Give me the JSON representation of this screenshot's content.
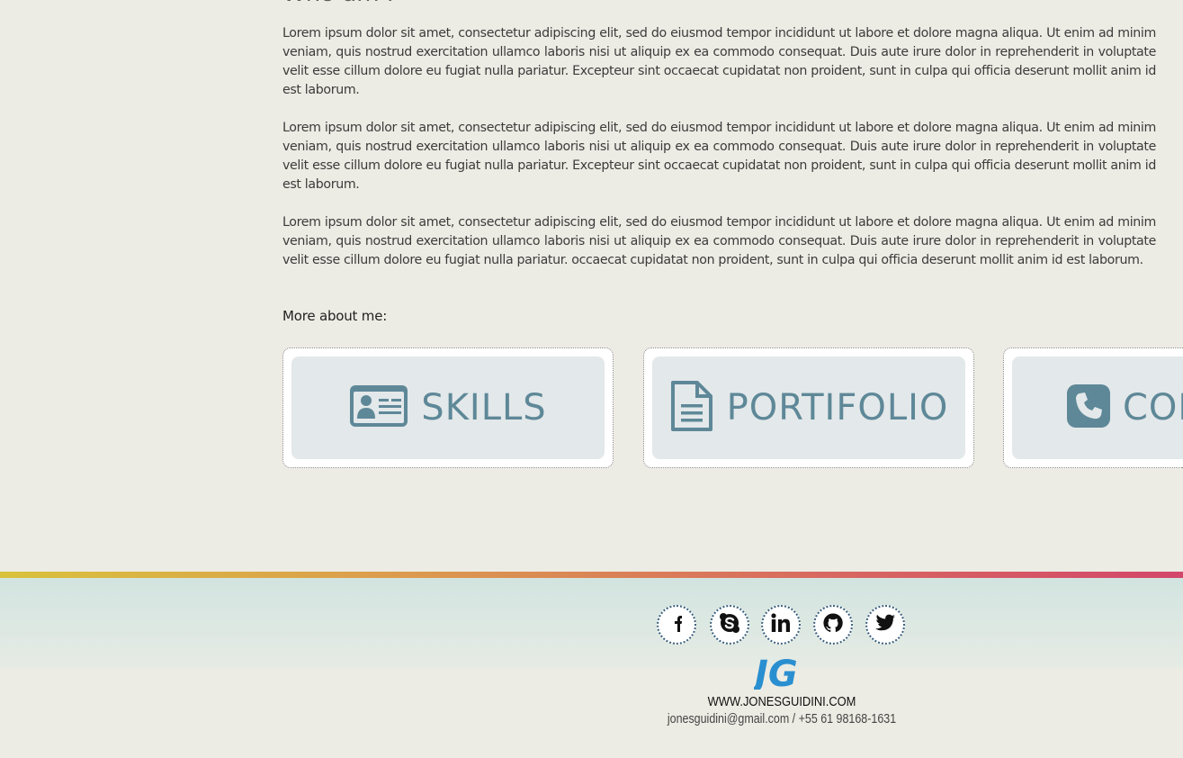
{
  "section": {
    "heading": "Who am I",
    "paragraphs": [
      "Lorem ipsum dolor sit amet, consectetur adipiscing elit, sed do eiusmod tempor incididunt ut labore et dolore magna aliqua. Ut enim ad minim veniam, quis nostrud exercitation ullamco laboris nisi ut aliquip ex ea commodo consequat. Duis aute irure dolor in reprehenderit in voluptate velit esse cillum dolore eu fugiat nulla pariatur. Excepteur sint occaecat cupidatat non proident, sunt in culpa qui officia deserunt mollit anim id est laborum.",
      "Lorem ipsum dolor sit amet, consectetur adipiscing elit, sed do eiusmod tempor incididunt ut labore et dolore magna aliqua. Ut enim ad minim veniam, quis nostrud exercitation ullamco laboris nisi ut aliquip ex ea commodo consequat. Duis aute irure dolor in reprehenderit in voluptate velit esse cillum dolore eu fugiat nulla pariatur. Excepteur sint occaecat cupidatat non proident, sunt in culpa qui officia deserunt mollit anim id est laborum.",
      "Lorem ipsum dolor sit amet, consectetur adipiscing elit, sed do eiusmod tempor incididunt ut labore et dolore magna aliqua. Ut enim ad minim veniam, quis nostrud exercitation ullamco laboris nisi ut aliquip ex ea commodo consequat. Duis aute irure dolor in reprehenderit in voluptate velit esse cillum dolore eu fugiat nulla pariatur. occaecat cupidatat non proident, sunt in culpa qui officia deserunt mollit anim id est laborum."
    ],
    "more_label": "More about me:"
  },
  "cards": [
    {
      "label": "SKILLS",
      "icon": "id-card-icon"
    },
    {
      "label": "PORTIFOLIO",
      "icon": "document-icon"
    },
    {
      "label": "CONTACT",
      "icon": "phone-icon"
    }
  ],
  "footer": {
    "socials": [
      "facebook-icon",
      "skype-icon",
      "linkedin-icon",
      "github-icon",
      "twitter-icon"
    ],
    "logo_text": "JG",
    "website": "WWW.JONESGUIDINI.COM",
    "contact": "jonesguidini@gmail.com / +55 61 98168-1631"
  },
  "colors": {
    "background": "#edece4",
    "card_text": "#5e8898",
    "logo": "#2a8fd0",
    "social_border": "#3a5f7c"
  }
}
